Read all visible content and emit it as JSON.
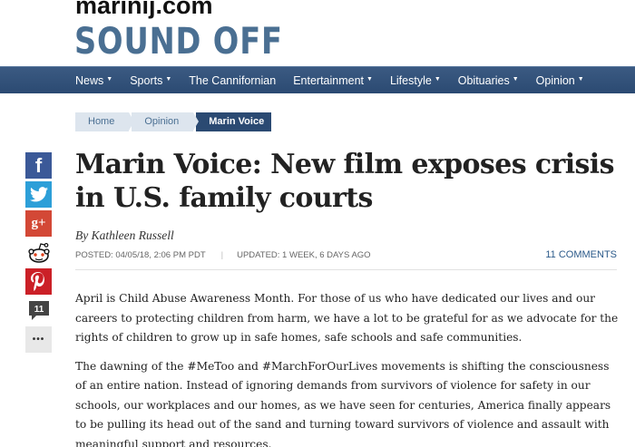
{
  "header": {
    "site_url": "marinij.com",
    "site_title": "SOUND OFF"
  },
  "nav": {
    "items": [
      {
        "label": "News",
        "dropdown": true
      },
      {
        "label": "Sports",
        "dropdown": true
      },
      {
        "label": "The Cannifornian",
        "dropdown": false
      },
      {
        "label": "Entertainment",
        "dropdown": true
      },
      {
        "label": "Lifestyle",
        "dropdown": true
      },
      {
        "label": "Obituaries",
        "dropdown": true
      },
      {
        "label": "Opinion",
        "dropdown": true
      }
    ],
    "caret": "▼"
  },
  "breadcrumb": {
    "items": [
      "Home",
      "Opinion",
      "Marin Voice"
    ]
  },
  "share": {
    "facebook_glyph": "f",
    "googleplus_glyph": "g+",
    "comment_count": "11",
    "more_glyph": "•••",
    "colors": {
      "facebook": "#3b5998",
      "twitter": "#2d9fd8",
      "googleplus": "#d34836",
      "pinterest": "#cb2027"
    }
  },
  "article": {
    "headline": "Marin Voice: New film exposes crisis in U.S. family courts",
    "byline": "By Kathleen Russell",
    "posted": "POSTED: 04/05/18, 2:06 PM PDT",
    "separator": "|",
    "updated": "UPDATED: 1 WEEK, 6 DAYS AGO",
    "comments_label": "11 COMMENTS",
    "paragraphs": [
      "April is Child Abuse Awareness Month. For those of us who have dedicated our lives and our careers to protecting children from harm, we have a lot to be grateful for as we advocate for the rights of children to grow up in safe homes, safe schools and safe communities.",
      "The dawning of the #MeToo and #MarchForOurLives movements is shifting the consciousness of an entire nation. Instead of ignoring demands from survivors of violence for safety in our schools, our workplaces and our homes, as we have seen for centuries, America finally appears to be pulling its head out of the sand and turning toward survivors of violence and assault with meaningful support and resources."
    ]
  },
  "colors": {
    "brand_blue": "#4a6f92",
    "nav_bg": "#2b4a72",
    "link": "#2b5a8a"
  }
}
